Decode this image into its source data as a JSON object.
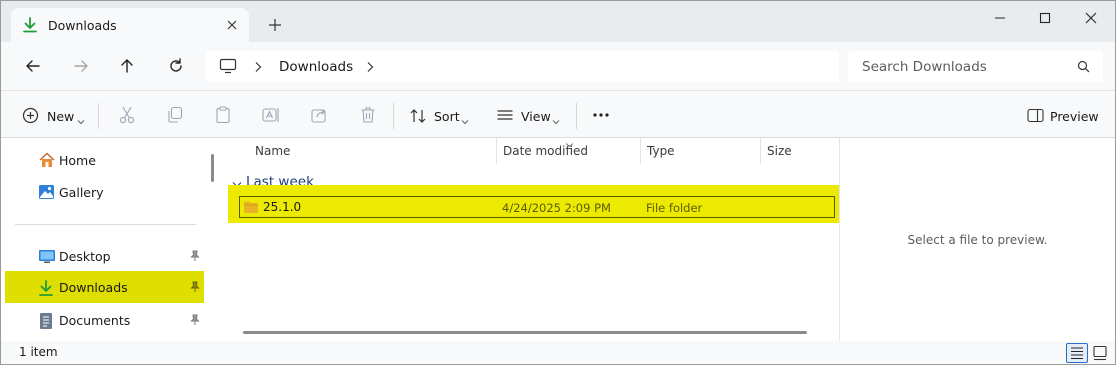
{
  "tab": {
    "title": "Downloads",
    "icon": "download-icon"
  },
  "window_controls": [
    "minimize-icon",
    "maximize-icon",
    "close-icon"
  ],
  "address": {
    "crumb": "Downloads"
  },
  "search": {
    "placeholder": "Search Downloads"
  },
  "toolbar": {
    "new_label": "New",
    "sort_label": "Sort",
    "view_label": "View",
    "preview_label": "Preview",
    "icons": [
      "cut-icon",
      "copy-icon",
      "paste-icon",
      "rename-icon",
      "share-icon",
      "delete-icon",
      "more-icon"
    ]
  },
  "sidebar": {
    "items": [
      {
        "label": "Home",
        "icon": "home-icon",
        "pinned": false
      },
      {
        "label": "Gallery",
        "icon": "gallery-icon",
        "pinned": false
      },
      {
        "label": "Desktop",
        "icon": "desktop-icon",
        "pinned": true
      },
      {
        "label": "Downloads",
        "icon": "download-icon",
        "pinned": true,
        "highlighted": true
      },
      {
        "label": "Documents",
        "icon": "documents-icon",
        "pinned": true
      }
    ]
  },
  "list": {
    "columns": [
      "Name",
      "Date modified",
      "Type",
      "Size"
    ],
    "group": "Last week",
    "rows": [
      {
        "name": "25.1.0",
        "date": "4/24/2025 2:09 PM",
        "type": "File folder",
        "size": ""
      }
    ]
  },
  "preview": {
    "message": "Select a file to preview."
  },
  "status": {
    "count": "1 item"
  },
  "colors": {
    "highlight": "#dede00",
    "accent": "#2a6ccb",
    "download_green": "#1f9d3a",
    "folder": "#e8b423"
  }
}
